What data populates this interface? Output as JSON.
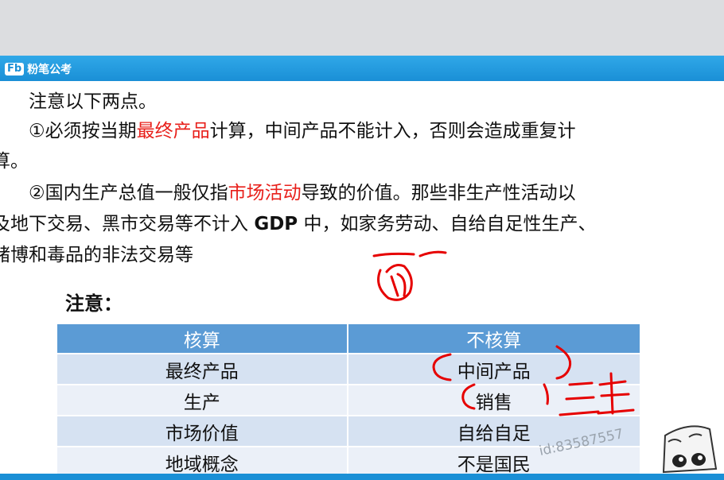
{
  "header": {
    "logo_mark": "Fb",
    "logo_text": "粉笔公考"
  },
  "paragraphs": {
    "intro": "注意以下两点。",
    "p1_line1_pre": "①必须按当期",
    "p1_line1_red": "最终产品",
    "p1_line1_post": "计算，中间产品不能计入，否则会造成重复计",
    "p1_line2": "算。",
    "p2_line1_pre": "②国内生产总值一般仅指",
    "p2_line1_red": "市场活动",
    "p2_line1_post": "导致的价值。那些非生产性活动以",
    "p2_line2_pre": "及地下交易、黑市交易等不计入 ",
    "p2_line2_bold": "GDP",
    "p2_line2_post": " 中，如家务劳动、自给自足性生产、",
    "p2_line3": "赌博和毒品的非法交易等"
  },
  "note_title": "注意：",
  "table": {
    "headers": [
      "核算",
      "不核算"
    ],
    "rows": [
      [
        "最终产品",
        "中间产品"
      ],
      [
        "生产",
        "销售"
      ],
      [
        "市场价值",
        "自给自足"
      ],
      [
        "地域概念",
        "不是国民"
      ]
    ]
  },
  "watermark": "id:83587557",
  "colors": {
    "header_blue": "#1a8fd6",
    "table_header": "#5b9bd5",
    "highlight_red": "#e8201b",
    "ink_red": "#e60000"
  }
}
